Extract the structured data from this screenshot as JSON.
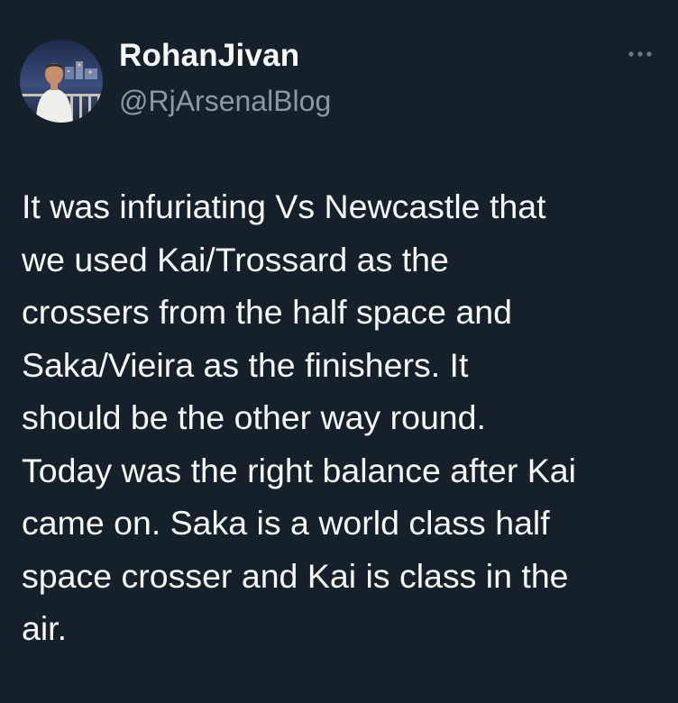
{
  "author": {
    "display_name": "RohanJivan",
    "handle": "@RjArsenalBlog",
    "avatar_icon": "profile-photo"
  },
  "more_icon": "more-options-icon",
  "tweet": {
    "text": "It was infuriating Vs Newcastle that\nwe used Kai/Trossard as the\ncrossers from the half space and\nSaka/Vieira as the finishers.  It\nshould be the other way round.\nToday was the right balance after Kai\ncame on. Saka is a world class half\nspace crosser and Kai is class in the\nair."
  },
  "colors": {
    "background": "#15202b",
    "text_primary": "#f7f9f9",
    "text_secondary": "#8b98a5"
  }
}
